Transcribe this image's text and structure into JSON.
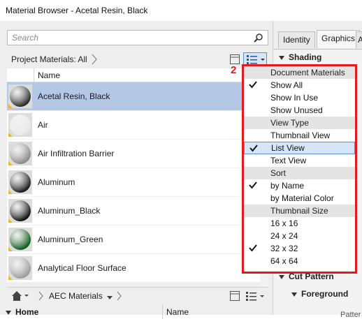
{
  "window": {
    "title": "Material Browser - Acetal Resin, Black"
  },
  "search": {
    "placeholder": "Search"
  },
  "toolbar": {
    "crumb": "Project Materials: All"
  },
  "list": {
    "header": "Name",
    "items": [
      {
        "name": "Acetal Resin, Black",
        "color": "#2a2a2a",
        "selected": true
      },
      {
        "name": "Air",
        "color": "#e8e8e8",
        "selected": false
      },
      {
        "name": "Air Infiltration Barrier",
        "color": "#8a8a8a",
        "selected": false
      },
      {
        "name": "Aluminum",
        "color": "#1a1a1a",
        "selected": false
      },
      {
        "name": "Aluminum_Black",
        "color": "#111111",
        "selected": false
      },
      {
        "name": "Aluminum_Green",
        "color": "#0f5c1a",
        "selected": false
      },
      {
        "name": "Analytical Floor Surface",
        "color": "#9a9a9a",
        "selected": false
      }
    ]
  },
  "library_bar": {
    "label": "AEC Materials"
  },
  "library_tree": {
    "home": "Home",
    "name_col": "Name"
  },
  "right_panel": {
    "tabs": [
      "Identity",
      "Graphics",
      "A"
    ],
    "shading": "Shading",
    "cut_pattern": "Cut Pattern",
    "foreground": "Foreground",
    "pattern_partial": "Patter"
  },
  "callout": "2",
  "menu": {
    "groups": [
      {
        "title": "Document Materials",
        "items": [
          {
            "label": "Show All",
            "checked": true,
            "active": false
          },
          {
            "label": "Show In Use",
            "checked": false,
            "active": false
          },
          {
            "label": "Show Unused",
            "checked": false,
            "active": false
          }
        ]
      },
      {
        "title": "View Type",
        "items": [
          {
            "label": "Thumbnail View",
            "checked": false,
            "active": false
          },
          {
            "label": "List View",
            "checked": true,
            "active": true
          },
          {
            "label": "Text View",
            "checked": false,
            "active": false
          }
        ]
      },
      {
        "title": "Sort",
        "items": [
          {
            "label": "by Name",
            "checked": true,
            "active": false
          },
          {
            "label": "by Material Color",
            "checked": false,
            "active": false
          }
        ]
      },
      {
        "title": "Thumbnail Size",
        "items": [
          {
            "label": "16 x 16",
            "checked": false,
            "active": false
          },
          {
            "label": "24 x 24",
            "checked": false,
            "active": false
          },
          {
            "label": "32 x 32",
            "checked": true,
            "active": false
          },
          {
            "label": "64 x 64",
            "checked": false,
            "active": false
          }
        ]
      }
    ]
  },
  "colors": {
    "highlight": "#e41b1b",
    "selection": "#b4c8e6"
  }
}
